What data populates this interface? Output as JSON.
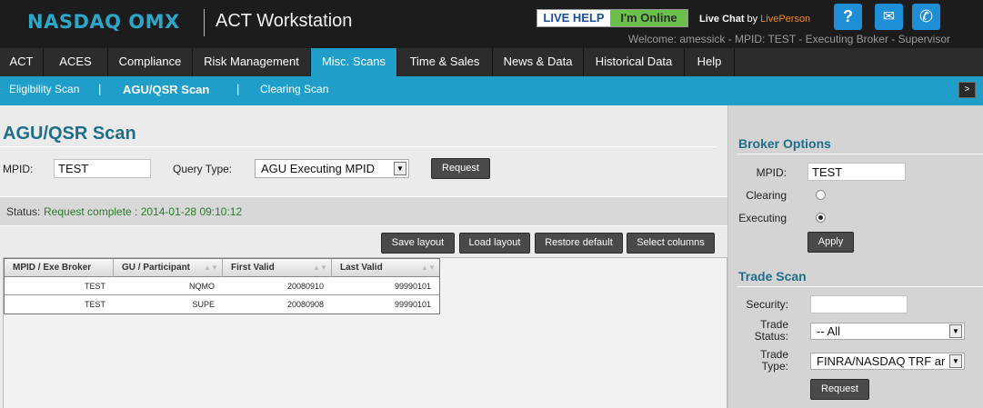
{
  "header": {
    "logo": "NASDAQ OMX",
    "app_title": "ACT Workstation",
    "live_help": "LIVE HELP",
    "online_status": "I'm Online",
    "live_chat": "Live Chat",
    "by": "by",
    "provider": "LivePerson",
    "welcome": "Welcome: amessick - MPID: TEST - Executing Broker - Supervisor",
    "help_icon": "?",
    "mail_icon": "✉",
    "phone_icon": "✆"
  },
  "main_nav": [
    {
      "label": "ACT"
    },
    {
      "label": "ACES"
    },
    {
      "label": "Compliance"
    },
    {
      "label": "Risk Management"
    },
    {
      "label": "Misc. Scans"
    },
    {
      "label": "Time & Sales"
    },
    {
      "label": "News & Data"
    },
    {
      "label": "Historical Data"
    },
    {
      "label": "Help"
    }
  ],
  "sub_nav": {
    "items": [
      {
        "label": "Eligibility Scan"
      },
      {
        "label": "AGU/QSR Scan"
      },
      {
        "label": "Clearing Scan"
      }
    ],
    "separator": "|",
    "expand_icon": ">"
  },
  "main": {
    "title": "AGU/QSR Scan",
    "mpid_label": "MPID:",
    "mpid_value": "TEST",
    "query_type_label": "Query Type:",
    "query_type_value": "AGU Executing MPID",
    "request_label": "Request",
    "status_label": "Status:",
    "status_value": "Request complete : 2014-01-28 09:10:12",
    "toolbar": {
      "save_layout": "Save layout",
      "load_layout": "Load layout",
      "restore_default": "Restore default",
      "select_columns": "Select columns"
    },
    "grid": {
      "columns": [
        "MPID / Exe Broker",
        "GU / Participant",
        "First Valid",
        "Last Valid"
      ],
      "sort_icon": "▲▼",
      "rows": [
        [
          "TEST",
          "NQMO",
          "20080910",
          "99990101"
        ],
        [
          "TEST",
          "SUPE",
          "20080908",
          "99990101"
        ]
      ]
    }
  },
  "broker_options": {
    "title": "Broker Options",
    "mpid_label": "MPID:",
    "mpid_value": "TEST",
    "clearing_label": "Clearing",
    "executing_label": "Executing",
    "apply_label": "Apply"
  },
  "trade_scan": {
    "title": "Trade Scan",
    "security_label": "Security:",
    "security_value": "",
    "trade_status_label_1": "Trade",
    "trade_status_label_2": "Status:",
    "trade_status_value": "-- All",
    "trade_type_label_1": "Trade",
    "trade_type_label_2": "Type:",
    "trade_type_value": "FINRA/NASDAQ TRF ar",
    "request_label": "Request"
  }
}
